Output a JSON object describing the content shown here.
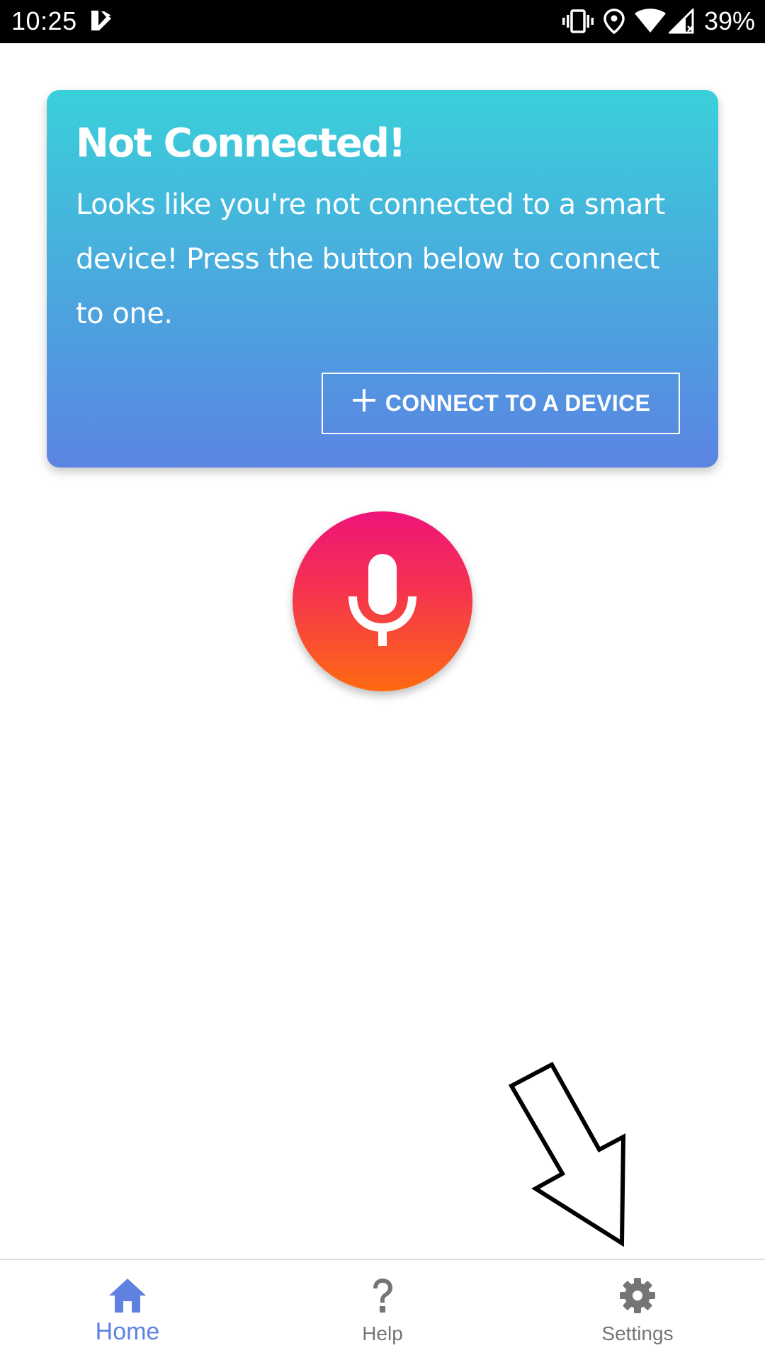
{
  "status_bar": {
    "time": "10:25",
    "battery": "39%",
    "icons": [
      "app-notification-icon",
      "vibrate-icon",
      "location-icon",
      "wifi-icon",
      "cell-signal-icon"
    ]
  },
  "card": {
    "title": "Not Connected!",
    "body": "Looks like you're not connected to a smart device! Press the button below to connect to one.",
    "button_label": "CONNECT TO A DEVICE",
    "button_icon": "plus-icon",
    "gradient": [
      "#3ad0da",
      "#5b84e3"
    ]
  },
  "mic_button": {
    "icon": "microphone-icon",
    "gradient": [
      "#ee1479",
      "#fe6a11"
    ]
  },
  "annotation": {
    "icon": "arrow-pointing-down-right-icon"
  },
  "bottom_nav": {
    "active_color": "#5f82e1",
    "inactive_color": "#757575",
    "items": [
      {
        "label": "Home",
        "icon": "home-icon",
        "active": true
      },
      {
        "label": "Help",
        "icon": "help-icon",
        "active": false
      },
      {
        "label": "Settings",
        "icon": "gear-icon",
        "active": false
      }
    ]
  }
}
